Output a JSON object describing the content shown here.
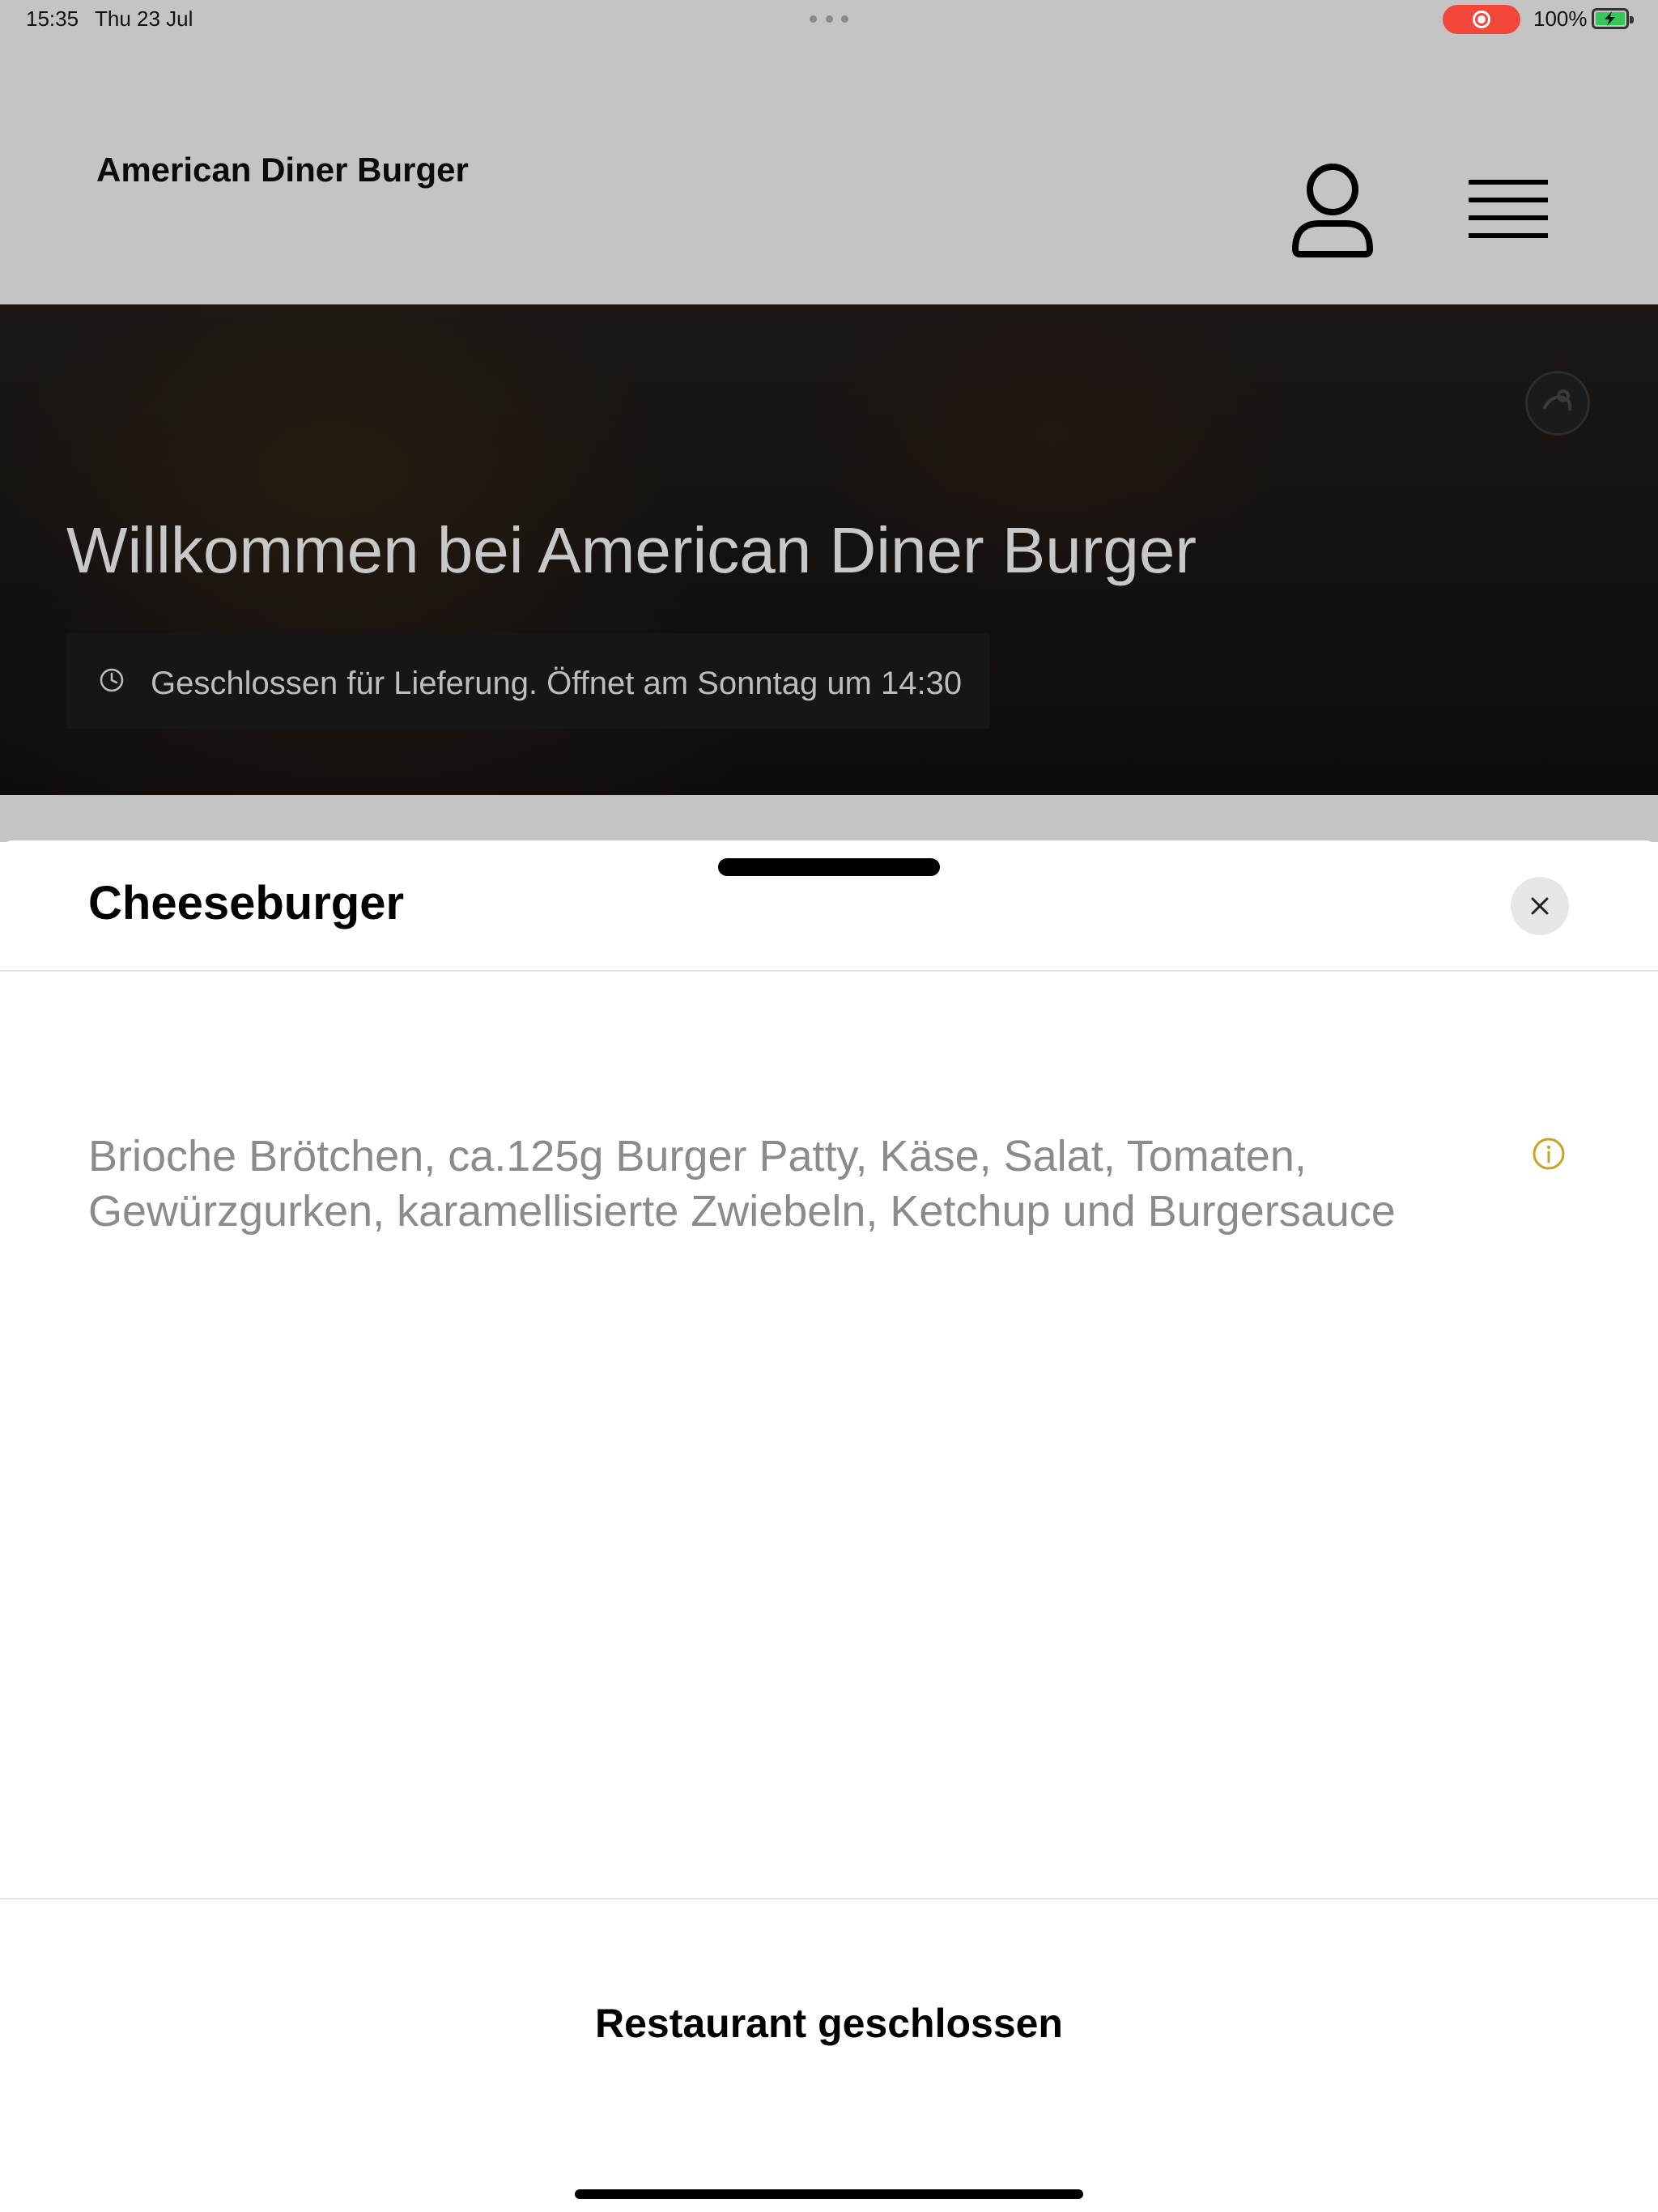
{
  "status_bar": {
    "time": "15:35",
    "date": "Thu 23 Jul",
    "battery_percent": "100%",
    "recording_color": "#f2473a",
    "battery_color": "#34c759"
  },
  "header": {
    "brand": "American Diner Burger",
    "user_icon": "user-icon",
    "menu_icon": "hamburger-menu-icon"
  },
  "hero": {
    "title": "Willkommen bei American Diner Burger",
    "notice": "Geschlossen für Lieferung. Öffnet am Sonntag um 14:30",
    "notice_icon": "clock-icon"
  },
  "sheet": {
    "title": "Cheeseburger",
    "close_icon": "close-icon",
    "description": "Brioche Brötchen, ca.125g Burger Patty, Käse, Salat, Tomaten, Gewürzgurken, karamellisierte Zwiebeln, Ketchup und Burgersauce",
    "info_icon": "info-icon",
    "info_color": "#c9a227",
    "footer_label": "Restaurant geschlossen"
  }
}
